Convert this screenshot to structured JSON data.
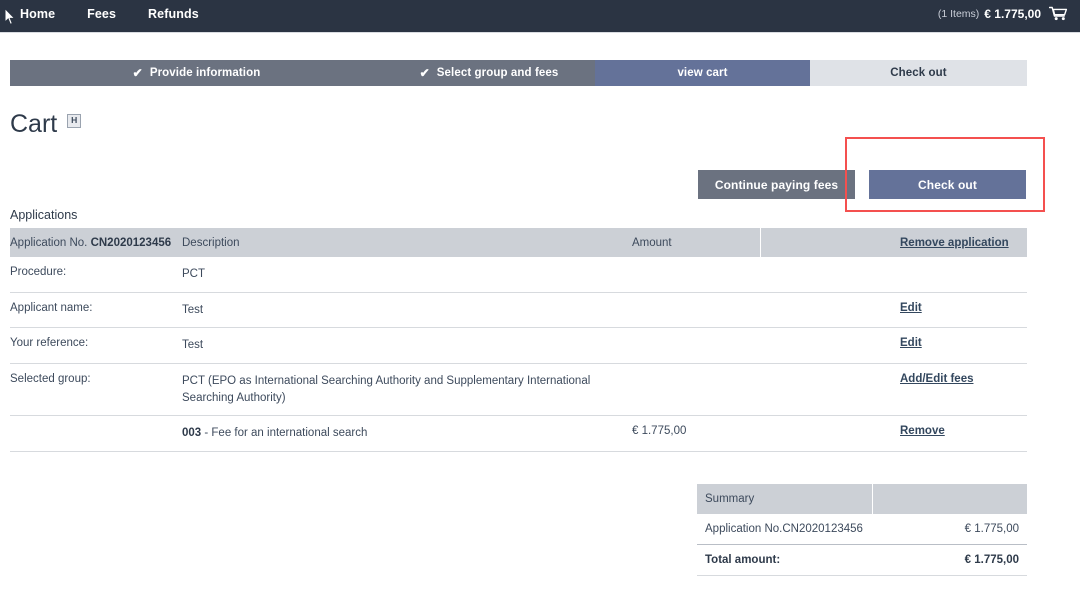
{
  "navbar": {
    "links": [
      {
        "label": "Home",
        "name": "nav-link-home"
      },
      {
        "label": "Fees",
        "name": "nav-link-fees"
      },
      {
        "label": "Refunds",
        "name": "nav-link-refunds"
      }
    ],
    "cart": {
      "items_text": "(1 Items)",
      "amount": "€ 1.775,00",
      "icon": "shopping-cart-icon"
    },
    "background_color": "#2b3443"
  },
  "steps": [
    {
      "label": "Provide information",
      "check": "✔",
      "state": "done"
    },
    {
      "label": "Select group and fees",
      "check": "✔",
      "state": "done"
    },
    {
      "label": "view cart",
      "check": "",
      "state": "active"
    },
    {
      "label": "Check out",
      "check": "",
      "state": "todo"
    }
  ],
  "step_colors": {
    "done": "#6b7280",
    "active": "#647299",
    "todo": "#dfe2e7"
  },
  "page": {
    "title": "Cart",
    "help_icon_label": "H",
    "help_icon_name": "help-icon"
  },
  "actions": {
    "continue_label": "Continue paying fees",
    "checkout_label": "Check out",
    "highlight_color": "#f4504f"
  },
  "applications": {
    "section_label": "Applications",
    "header": {
      "app_no_label": "Application No.",
      "app_no_value": "CN2020123456",
      "description": "Description",
      "amount": "Amount",
      "remove_application": "Remove application"
    },
    "rows": [
      {
        "label": "Procedure:",
        "value": "PCT",
        "amount": "",
        "link": ""
      },
      {
        "label": "Applicant name:",
        "value": "Test",
        "amount": "",
        "link": "Edit"
      },
      {
        "label": "Your reference:",
        "value": "Test",
        "amount": "",
        "link": "Edit"
      },
      {
        "label": "Selected group:",
        "value": "PCT (EPO as International Searching Authority and Supplementary International Searching Authority)",
        "amount": "",
        "link": "Add/Edit fees"
      }
    ],
    "fee_row": {
      "code": "003",
      "description": " - Fee for an international search",
      "amount": "€ 1.775,00",
      "link": "Remove"
    }
  },
  "summary": {
    "header": "Summary",
    "rows": [
      {
        "label": "Application No.CN2020123456",
        "value": "€ 1.775,00"
      }
    ],
    "total": {
      "label": "Total amount:",
      "value": "€ 1.775,00"
    }
  }
}
